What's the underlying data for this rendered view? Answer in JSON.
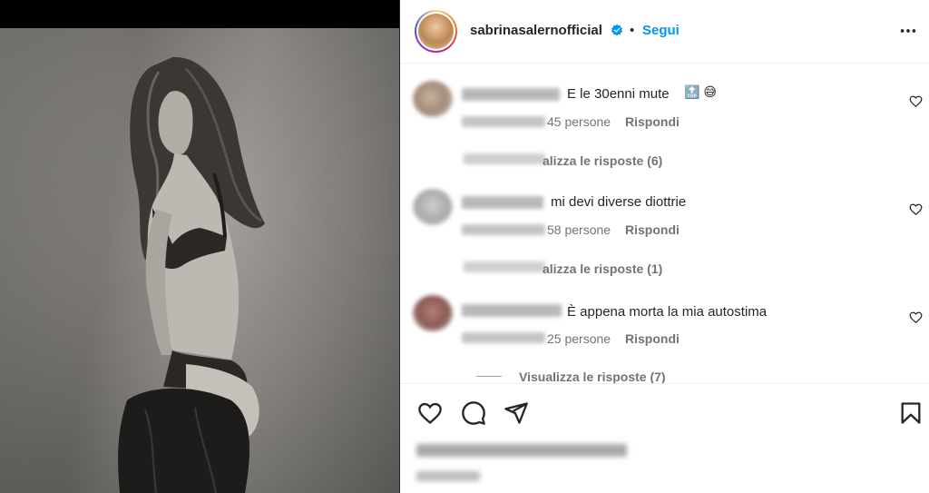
{
  "post": {
    "username": "sabrinasalernofficial",
    "follow_label": "Segui",
    "separator": "•"
  },
  "comments": [
    {
      "text": "E le 30enni mute",
      "emoji": "🔝 😅",
      "likes": "45 persone",
      "reply_label": "Rispondi",
      "view_replies": "alizza le risposte (6)"
    },
    {
      "text": "mi devi diverse diottrie",
      "likes": "58 persone",
      "reply_label": "Rispondi",
      "view_replies": "alizza le risposte (1)"
    },
    {
      "text": "È appena morta la mia autostima",
      "likes": "25 persone",
      "reply_label": "Rispondi",
      "view_replies": "Visualizza le risposte (7)"
    }
  ],
  "icons": {
    "verified": "verified-badge-icon",
    "more": "more-options-icon",
    "like": "heart-icon",
    "comment": "comment-icon",
    "share": "share-icon",
    "save": "bookmark-icon"
  },
  "colors": {
    "accent": "#0095f6",
    "text": "#262626",
    "secondary": "#737373"
  }
}
